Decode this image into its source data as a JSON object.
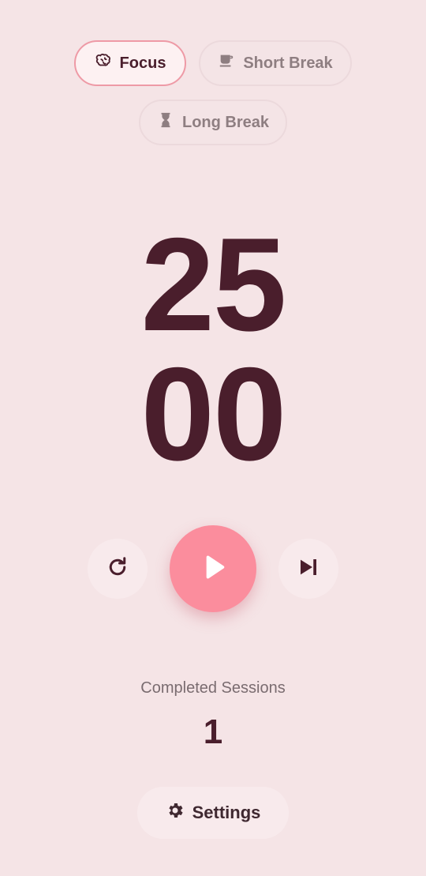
{
  "modes": {
    "focus": {
      "label": "Focus",
      "icon": "brain-icon",
      "active": true
    },
    "short_break": {
      "label": "Short Break",
      "icon": "coffee-cup-icon",
      "active": false
    },
    "long_break": {
      "label": "Long Break",
      "icon": "hourglass-icon",
      "active": false
    }
  },
  "timer": {
    "minutes": "25",
    "seconds": "00"
  },
  "controls": {
    "reset_icon": "refresh-icon",
    "play_icon": "play-icon",
    "skip_icon": "skip-next-icon"
  },
  "sessions": {
    "label": "Completed Sessions",
    "count": "1"
  },
  "settings": {
    "label": "Settings",
    "icon": "gear-icon"
  },
  "colors": {
    "background": "#f5e4e6",
    "accent": "#fb8d9d",
    "text_primary": "#4a1e2c",
    "chip_active_border": "#ee9aa6"
  }
}
